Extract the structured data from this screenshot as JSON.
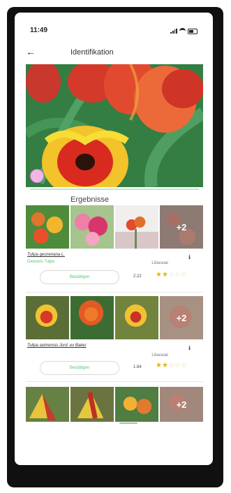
{
  "status_bar": {
    "time": "11:49"
  },
  "header": {
    "title": "Identifikation"
  },
  "results": {
    "label": "Ergebnisse"
  },
  "cards": [
    {
      "scientific_name": "Tulipa gesneriana L.",
      "common_name": "Gesners Tulpe",
      "family": "Liliaceae",
      "confirm_label": "Bestätigen",
      "score": "2.22",
      "rating": 2,
      "max_rating": 5,
      "more_count": "+2"
    },
    {
      "scientific_name": "Tulipa aximensis Jord. ex Baker",
      "common_name": "",
      "family": "Liliaceae",
      "confirm_label": "Bestätigen",
      "score": "1.84",
      "rating": 2,
      "max_rating": 5,
      "more_count": "+2"
    },
    {
      "more_count": "+2"
    }
  ],
  "colors": {
    "accent_green": "#53c972",
    "star": "#e1b70c",
    "divider": "#b9e6d4"
  }
}
